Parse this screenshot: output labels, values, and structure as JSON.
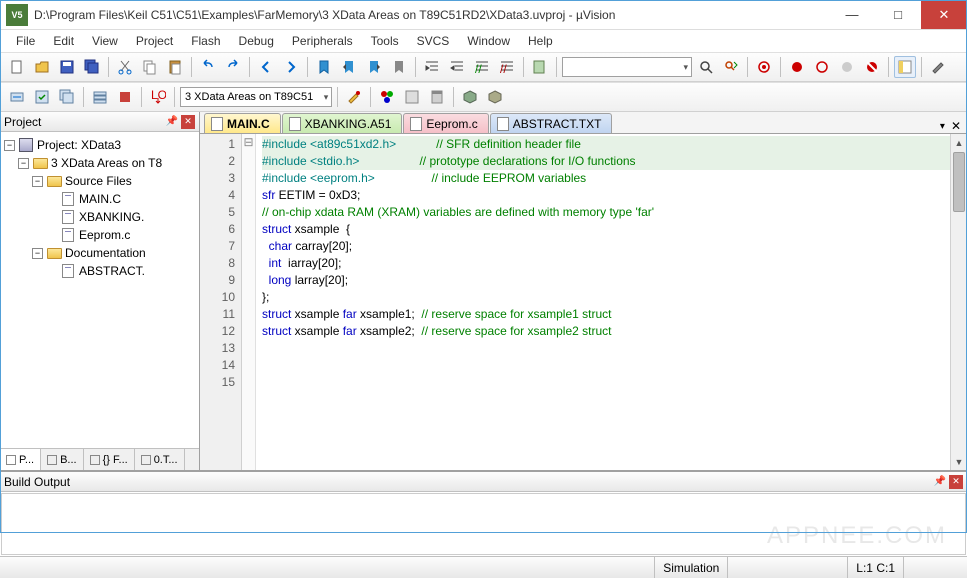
{
  "title": "D:\\Program Files\\Keil C51\\C51\\Examples\\FarMemory\\3 XData Areas on T89C51RD2\\XData3.uvproj - µVision",
  "menu": [
    "File",
    "Edit",
    "View",
    "Project",
    "Flash",
    "Debug",
    "Peripherals",
    "Tools",
    "SVCS",
    "Window",
    "Help"
  ],
  "target_combo": "3 XData Areas on T89C51",
  "project": {
    "panel_title": "Project",
    "root": "Project: XData3",
    "target": "3 XData Areas on T8",
    "groups": [
      {
        "name": "Source Files",
        "files": [
          "MAIN.C",
          "XBANKING.",
          "Eeprom.c"
        ]
      },
      {
        "name": "Documentation",
        "files": [
          "ABSTRACT."
        ]
      }
    ],
    "bottom_tabs": [
      "P...",
      "B...",
      "{} F...",
      "0.T..."
    ]
  },
  "tabs": [
    {
      "label": "MAIN.C",
      "style": "active"
    },
    {
      "label": "XBANKING.A51",
      "style": "green"
    },
    {
      "label": "Eeprom.c",
      "style": "pink"
    },
    {
      "label": "ABSTRACT.TXT",
      "style": "blue"
    }
  ],
  "code": {
    "lines": [
      {
        "n": 1,
        "hl": true,
        "html": "<span class='pre'>#include</span> <span class='inc'>&lt;at89c51xd2.h&gt;</span>            <span class='cmt'>// SFR definition header file</span>"
      },
      {
        "n": 2,
        "hl": true,
        "html": "<span class='pre'>#include</span> <span class='inc'>&lt;stdio.h&gt;</span>                  <span class='cmt'>// prototype declarations for I/O functions</span>"
      },
      {
        "n": 3,
        "hl": false,
        "html": "<span class='pre'>#include</span> <span class='inc'>&lt;eeprom.h&gt;</span>                 <span class='cmt'>// include EEPROM variables</span>"
      },
      {
        "n": 4,
        "hl": false,
        "html": ""
      },
      {
        "n": 5,
        "hl": false,
        "html": "<span class='kw'>sfr</span> EETIM = <span class='num'>0xD3</span>;"
      },
      {
        "n": 6,
        "hl": false,
        "html": ""
      },
      {
        "n": 7,
        "hl": false,
        "html": "<span class='cmt'>// on-chip xdata RAM (XRAM) variables are defined with memory type 'far'</span>"
      },
      {
        "n": 8,
        "hl": false,
        "fold": "⊟",
        "html": "<span class='kw'>struct</span> xsample  {"
      },
      {
        "n": 9,
        "hl": false,
        "html": "  <span class='kw'>char</span> carray[<span class='num'>20</span>];"
      },
      {
        "n": 10,
        "hl": false,
        "html": "  <span class='kw'>int</span>  iarray[<span class='num'>20</span>];"
      },
      {
        "n": 11,
        "hl": false,
        "html": "  <span class='kw'>long</span> larray[<span class='num'>20</span>];"
      },
      {
        "n": 12,
        "hl": false,
        "html": "};"
      },
      {
        "n": 13,
        "hl": false,
        "html": ""
      },
      {
        "n": 14,
        "hl": false,
        "html": "<span class='kw'>struct</span> xsample <span class='kw'>far</span> xsample1;  <span class='cmt'>// reserve space for xsample1 struct</span>"
      },
      {
        "n": 15,
        "hl": false,
        "html": "<span class='kw'>struct</span> xsample <span class='kw'>far</span> xsample2;  <span class='cmt'>// reserve space for xsample2 struct</span>"
      }
    ]
  },
  "build_output_title": "Build Output",
  "status": {
    "mode": "Simulation",
    "pos": "L:1 C:1"
  },
  "watermark": "APPNEE.COM"
}
